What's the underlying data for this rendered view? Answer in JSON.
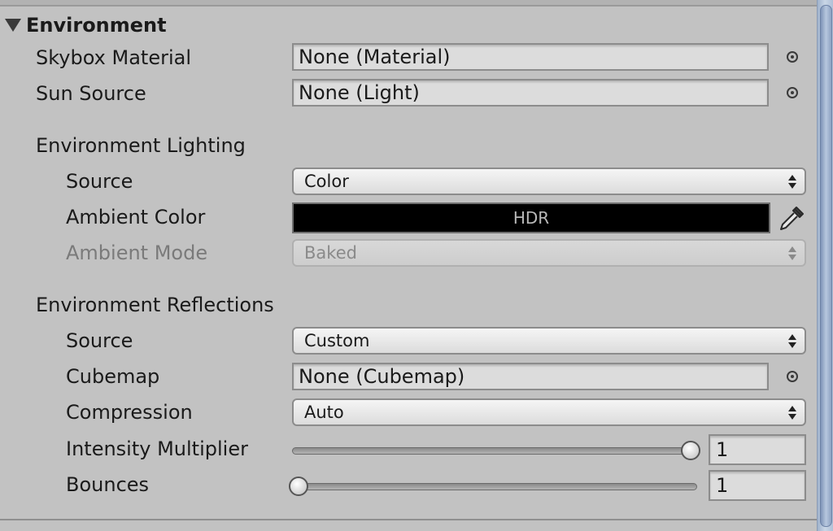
{
  "section": {
    "title": "Environment"
  },
  "skybox": {
    "label": "Skybox Material",
    "value": "None (Material)"
  },
  "sun": {
    "label": "Sun Source",
    "value": "None (Light)"
  },
  "lighting": {
    "header": "Environment Lighting",
    "source_label": "Source",
    "source_value": "Color",
    "ambient_color_label": "Ambient Color",
    "ambient_color_text": "HDR",
    "ambient_color_hex": "#000000",
    "ambient_mode_label": "Ambient Mode",
    "ambient_mode_value": "Baked"
  },
  "reflections": {
    "header": "Environment Reflections",
    "source_label": "Source",
    "source_value": "Custom",
    "cubemap_label": "Cubemap",
    "cubemap_value": "None (Cubemap)",
    "compression_label": "Compression",
    "compression_value": "Auto",
    "intensity_label": "Intensity Multiplier",
    "intensity_value": "1",
    "intensity_slider_fraction": 1.0,
    "bounces_label": "Bounces",
    "bounces_value": "1",
    "bounces_slider_fraction": 0.0
  },
  "icons": {
    "picker": "object-picker-icon",
    "eyedropper": "eyedropper-icon",
    "foldout": "foldout-triangle-icon"
  }
}
